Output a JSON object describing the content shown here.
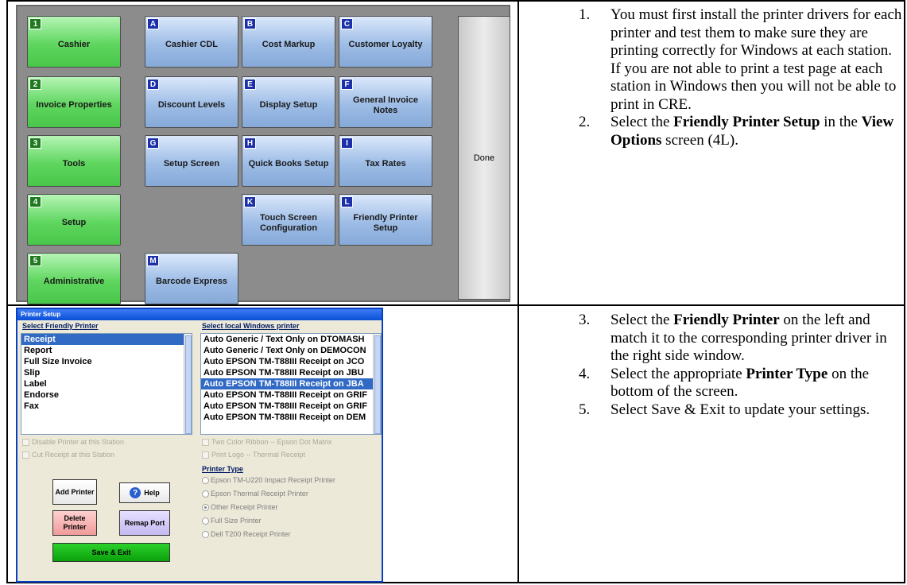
{
  "view_options": {
    "buttons": [
      {
        "key": "1",
        "label": "Cashier",
        "color": "green"
      },
      {
        "key": "A",
        "label": "Cashier CDL",
        "color": "blue"
      },
      {
        "key": "B",
        "label": "Cost Markup",
        "color": "blue"
      },
      {
        "key": "C",
        "label": "Customer Loyalty",
        "color": "blue"
      },
      {
        "key": "2",
        "label": "Invoice Properties",
        "color": "green"
      },
      {
        "key": "D",
        "label": "Discount Levels",
        "color": "blue"
      },
      {
        "key": "E",
        "label": "Display Setup",
        "color": "blue"
      },
      {
        "key": "F",
        "label": "General Invoice Notes",
        "color": "blue"
      },
      {
        "key": "3",
        "label": "Tools",
        "color": "green"
      },
      {
        "key": "G",
        "label": "Setup Screen",
        "color": "blue"
      },
      {
        "key": "H",
        "label": "Quick Books Setup",
        "color": "blue"
      },
      {
        "key": "I",
        "label": "Tax Rates",
        "color": "blue"
      },
      {
        "key": "4",
        "label": "Setup",
        "color": "green"
      },
      {
        "key": "K",
        "label": "Touch Screen Configuration",
        "color": "blue"
      },
      {
        "key": "L",
        "label": "Friendly Printer Setup",
        "color": "blue"
      },
      {
        "key": "5",
        "label": "Administrative",
        "color": "green"
      },
      {
        "key": "M",
        "label": "Barcode Express",
        "color": "blue"
      }
    ],
    "done_label": "Done"
  },
  "printer_setup": {
    "title": "Printer Setup",
    "friendly_heading": "Select Friendly Printer",
    "windows_heading": "Select local Windows printer",
    "friendly_printers": [
      "Receipt",
      "Report",
      "Full Size Invoice",
      "Slip",
      "Label",
      "Endorse",
      "Fax"
    ],
    "windows_printers": [
      "Auto Generic / Text Only on DTOMASH",
      "Auto Generic / Text Only on DEMOCON",
      "Auto EPSON TM-T88III Receipt on JCO",
      "Auto EPSON TM-T88III Receipt on JBU",
      "Auto EPSON TM-T88III Receipt on JBA",
      "Auto EPSON TM-T88III Receipt on GRIF",
      "Auto EPSON TM-T88III Receipt on GRIF",
      "Auto EPSON TM-T88III Receipt on DEM"
    ],
    "disable_printer": "Disable Printer at this Station",
    "cut_receipt": "Cut Receipt at this Station",
    "two_color": "Two Color Ribbon -- Epson Dot Matrix",
    "print_logo": "Print Logo -- Thermal Receipt",
    "printer_type_heading": "Printer Type",
    "printer_types": [
      "Epson TM-U220 Impact Receipt Printer",
      "Epson Thermal Receipt Printer",
      "Other Receipt Printer",
      "Full Size Printer",
      "Dell T200 Receipt Printer"
    ],
    "selected_printer_type": "Other Receipt Printer",
    "add_printer": "Add Printer",
    "help": "Help",
    "delete_printer": "Delete Printer",
    "remap_port": "Remap Port",
    "save_exit": "Save & Exit"
  },
  "instructions": {
    "step1_num": "1.",
    "step1_text": "You must first install the printer drivers for each printer and test them to make sure they are printing correctly for Windows at each station.  If you are not able to print a test page at each station in Windows then you will not be able to print in CRE.",
    "step2_num": "2.",
    "step2_pre": "Select the ",
    "step2_b1": "Friendly Printer Setup",
    "step2_mid": " in the ",
    "step2_b2": "View Options",
    "step2_post": " screen (4L).",
    "step3_num": "3.",
    "step3_pre": "Select the ",
    "step3_b1": "Friendly Printer",
    "step3_post": " on the left and match it to the corresponding printer driver in the right side window.",
    "step4_num": "4.",
    "step4_pre": "Select the appropriate ",
    "step4_b1": "Printer Type",
    "step4_post": " on the bottom of the screen.",
    "step5_num": "5.",
    "step5_text": "Select Save & Exit to update your settings."
  }
}
